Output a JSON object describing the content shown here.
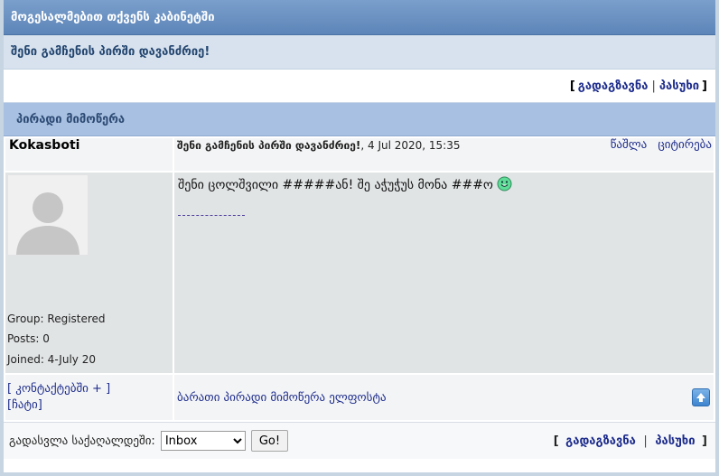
{
  "header": {
    "title": "მოგესალმებით თქვენს კაბინეტში"
  },
  "notice": {
    "text": "შენი გამჩენის პირში დავანძრიე!"
  },
  "top_actions": {
    "open": "[",
    "forward": "გადაგზავნა",
    "sep": "|",
    "reply": "პასუხი",
    "close": "]"
  },
  "section": {
    "title": "პირადი მიმოწერა"
  },
  "message": {
    "author": "Kokasboti",
    "subject": "შენი გამჩენის პირში დავანძრიე!",
    "date": ", 4 Jul 2020, 15:35",
    "delete": "წაშლა",
    "quote": "ციტირება",
    "body": "შენი ცოლშვილი #####ან! შე აჭუჭუს მონა ###ო",
    "profile": {
      "group": "Group: Registered",
      "posts": "Posts: 0",
      "joined": "Joined: 4-July 20"
    },
    "add_contact": "[ კონტაქტებში + ]",
    "chat": "[ჩატი]",
    "footer_link": "ბარათი პირადი მიმოწერა ელფოსტა"
  },
  "bottom": {
    "jump_label": "გადასვლა საქაღალდეში:",
    "folder_selected": "Inbox",
    "go": "Go!",
    "open": "[",
    "forward": "გადაგზავნა",
    "sep": "|",
    "reply": "პასუხი",
    "close": "]"
  },
  "colors": {
    "header": "#5d85b8",
    "section": "#a8c1e2",
    "link": "#1d2c8c",
    "post_bg": "#e1e4e5"
  },
  "icons": [
    "smiley-icon",
    "scroll-up-icon",
    "avatar-placeholder-icon",
    "dropdown-arrow-icon"
  ]
}
